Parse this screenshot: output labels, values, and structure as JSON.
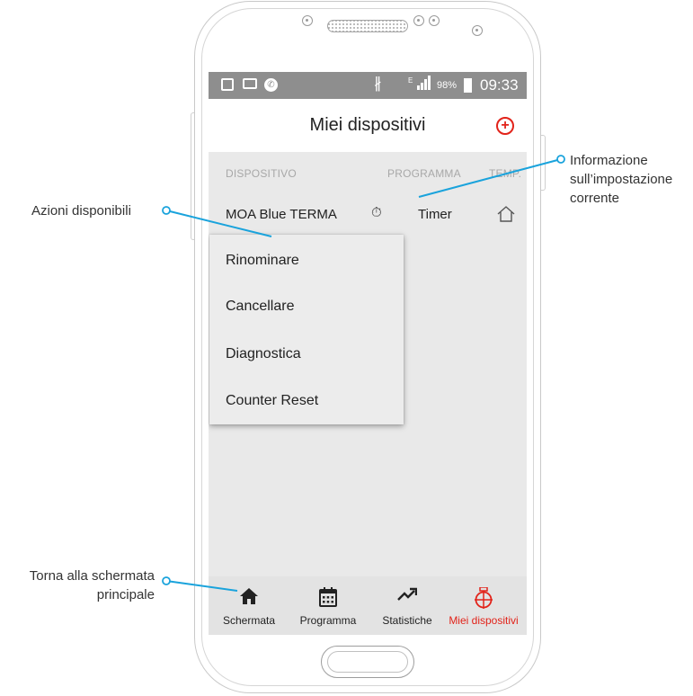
{
  "statusbar": {
    "battery": "98%",
    "time": "09:33",
    "icons": [
      "gallery-icon",
      "mail-icon",
      "phone-icon",
      "bluetooth-icon",
      "signal-icon",
      "battery-icon"
    ]
  },
  "header": {
    "title": "Miei dispositivi",
    "add_icon": "plus-circle-icon"
  },
  "columns": {
    "device": "DISPOSITIVO",
    "program": "PROGRAMMA",
    "temp": "TEMP."
  },
  "device_row": {
    "name": "MOA Blue TERMA",
    "program_icon": "timer-icon",
    "program": "Timer",
    "temp_icon": "home-icon"
  },
  "menu": {
    "items": [
      "Rinominare",
      "Cancellare",
      "Diagnostica",
      "Counter Reset"
    ]
  },
  "bottom_nav": {
    "items": [
      {
        "label": "Schermata",
        "icon": "home-icon"
      },
      {
        "label": "Programma",
        "icon": "calendar-icon"
      },
      {
        "label": "Statistiche",
        "icon": "trending-up-icon"
      },
      {
        "label": "Miei dispositivi",
        "icon": "devices-icon",
        "active": true
      }
    ]
  },
  "annotations": {
    "actions": "Azioni disponibili",
    "info_line1": "Informazione",
    "info_line2": "sull’impostazione",
    "info_line3": "corrente",
    "home_line1": "Torna alla schermata",
    "home_line2": "principale"
  },
  "colors": {
    "accent": "#e2231a",
    "callout": "#1aa3dc",
    "statusbar": "#8e8e8e"
  }
}
